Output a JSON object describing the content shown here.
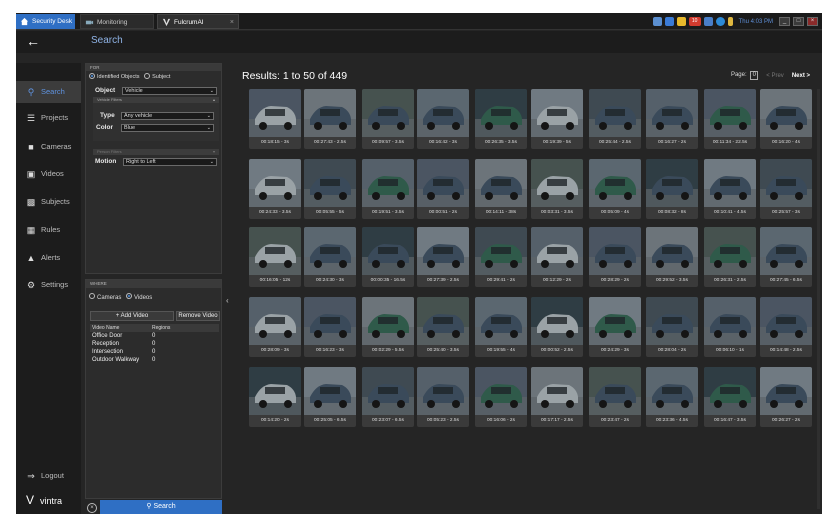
{
  "tabs": [
    {
      "label": "Security Desk",
      "active": false
    },
    {
      "label": "Monitoring",
      "active": false
    },
    {
      "label": "FulcrumAI",
      "active": true
    }
  ],
  "tray": {
    "clock": "Thu 4:03 PM",
    "badge": "10"
  },
  "header": {
    "title": "Search"
  },
  "nav": {
    "items": [
      "Search",
      "Projects",
      "Cameras",
      "Videos",
      "Subjects",
      "Rules",
      "Alerts",
      "Settings"
    ],
    "logout": "Logout",
    "brand": "vintra"
  },
  "filters": {
    "section_for": "FOR",
    "mode_options": [
      "Identified Objects",
      "Subject"
    ],
    "object_label": "Object",
    "object_value": "Vehicle",
    "vehicle_filters_label": "Vehicle Filters",
    "type_label": "Type",
    "type_value": "Any vehicle",
    "color_label": "Color",
    "color_value": "Blue",
    "person_filters_label": "Person Filters",
    "motion_label": "Motion",
    "motion_value": "Right to Left"
  },
  "where": {
    "section_label": "WHERE",
    "options": [
      "Cameras",
      "Videos"
    ],
    "add_video": "+ Add Video",
    "remove_video": "Remove Video",
    "columns": [
      "Video Name",
      "Regions"
    ],
    "rows": [
      {
        "name": "Office Door",
        "regions": "0"
      },
      {
        "name": "Reception",
        "regions": "0"
      },
      {
        "name": "Intersection",
        "regions": "0"
      },
      {
        "name": "Outdoor Walkway",
        "regions": "0"
      }
    ]
  },
  "search_button": "Search",
  "results": {
    "title": "Results:",
    "range": "1 to 50 of 449",
    "page_label": "Page:",
    "page": "0",
    "prev": "< Prev",
    "next": "Next >",
    "captions": [
      "00:18:15 - 3s",
      "00:27:43 - 2.5s",
      "00:09:57 - 3.5s",
      "00:16:42 - 3s",
      "00:26:35 - 3.5s",
      "00:19:39 - 5s",
      "00:25:44 - 2.5s",
      "00:16:27 - 2s",
      "00:11:34 - 22.5s",
      "00:16:20 - 4s",
      "00:24:33 - 3.5s",
      "00:05:55 - 5s",
      "00:19:51 - 3.5s",
      "00:00:51 - 2s",
      "00:14:11 - 38s",
      "00:03:31 - 3.5s",
      "00:05:09 - 4s",
      "00:08:32 - 8s",
      "00:10:41 - 4.5s",
      "00:25:57 - 3s",
      "00:16:05 - 12s",
      "00:24:30 - 3s",
      "00:00:35 - 16.5s",
      "00:27:39 - 2.5s",
      "00:29:41 - 2s",
      "00:12:29 - 2s",
      "00:28:29 - 2s",
      "00:29:52 - 3.5s",
      "00:26:31 - 2.5s",
      "00:27:45 - 6.5s",
      "00:28:09 - 3s",
      "00:16:23 - 3s",
      "00:02:29 - 5.5s",
      "00:25:40 - 3.5s",
      "00:19:55 - 4s",
      "00:00:52 - 2.5s",
      "00:24:29 - 3s",
      "00:28:04 - 2s",
      "00:06:10 - 1s",
      "00:14:48 - 2.5s",
      "00:14:20 - 2s",
      "00:25:05 - 6.5s",
      "00:23:07 - 6.5s",
      "00:05:23 - 2.5s",
      "00:16:06 - 2s",
      "00:17:17 - 2.5s",
      "00:23:47 - 2s",
      "00:23:36 - 4.5s",
      "00:16:47 - 3.5s",
      "00:26:27 - 2s"
    ]
  },
  "colors": {
    "accent": "#2f6fc4",
    "background": "#252525",
    "nav_active": "#5f93e0"
  }
}
